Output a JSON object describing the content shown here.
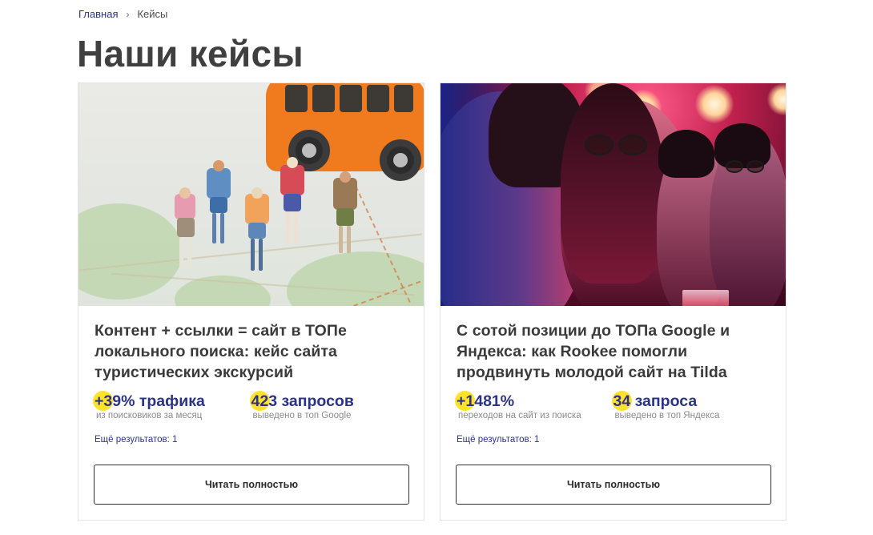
{
  "breadcrumb": {
    "home": "Главная",
    "separator": "›",
    "current": "Кейсы"
  },
  "page_title": "Наши кейсы",
  "cards": [
    {
      "image_alt": "miniature travellers on a map",
      "title": "Контент + ссылки = сайт в ТОПе локального поиска: кейс сайта туристических экскурсий",
      "stats": [
        {
          "value": "+39% трафика",
          "label": "из поисковиков за месяц"
        },
        {
          "value": "423 запросов",
          "label": "выведено в топ Google"
        }
      ],
      "more": "Ещё результатов: 1",
      "button": "Читать полностью"
    },
    {
      "image_alt": "young people at a party",
      "title": "С сотой позиции до ТОПа Google и Яндекса: как Rookee помогли продвинуть молодой сайт на Tilda",
      "stats": [
        {
          "value": "+1481%",
          "label": "переходов на сайт из поиска"
        },
        {
          "value": "34 запроса",
          "label": "выведено в топ Яндекса"
        }
      ],
      "more": "Ещё результатов: 1",
      "button": "Читать полностью"
    }
  ],
  "colors": {
    "accent": "#2b3387",
    "highlight": "#ffe229",
    "title": "#3f3f3f"
  }
}
